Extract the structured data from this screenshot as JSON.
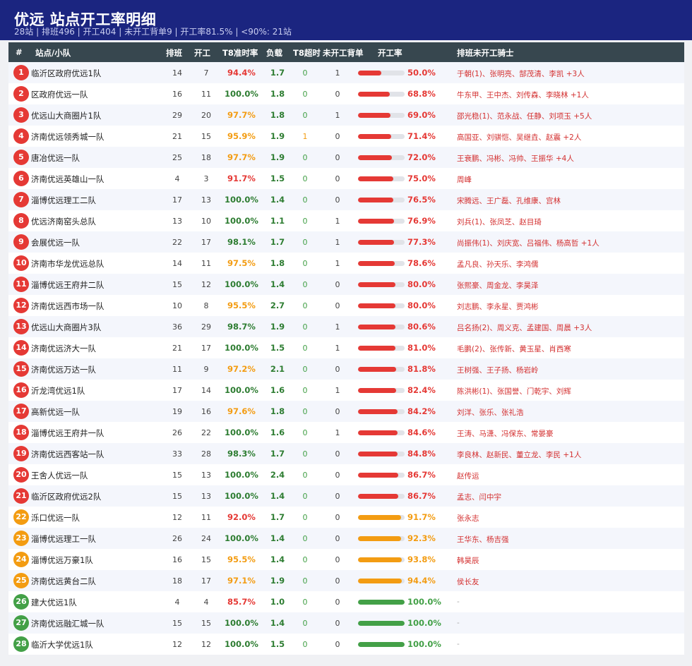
{
  "header": {
    "title": "优远 站点开工率明细",
    "subtitle": "28站 | 排班496 | 开工404 | 未开工背单9 | 开工率81.5% | <90%: 21站"
  },
  "columns": {
    "rank": "#",
    "station": "站点/小队",
    "scheduled": "排班",
    "working": "开工",
    "t8_rate": "T8准时率",
    "load": "负载",
    "t8_overtime": "T8超时",
    "not_working": "未开工背单",
    "work_rate": "开工率",
    "riders": "排班未开工骑士"
  },
  "colors": {
    "red": "#e53935",
    "orange": "#f39c12",
    "green": "#43a047",
    "t8_red": "#e53935",
    "t8_orange": "#f39c12",
    "t8_green": "#2e7d32"
  },
  "rows": [
    {
      "rank": "1",
      "name": "临沂区政府优远1队",
      "scheduled": "14",
      "working": "7",
      "t8": "94.4%",
      "load": "1.7",
      "t8_over": "0",
      "not_working": "1",
      "rate": "50.0%",
      "rate_value": 50.0,
      "riders": "于朝(1)、张明亮、郜茂清、李凯 +3人"
    },
    {
      "rank": "2",
      "name": "区政府优远一队",
      "scheduled": "16",
      "working": "11",
      "t8": "100.0%",
      "load": "1.8",
      "t8_over": "0",
      "not_working": "0",
      "rate": "68.8%",
      "rate_value": 68.8,
      "riders": "牛东甲、王中杰、刘传森、李晓林 +1人"
    },
    {
      "rank": "3",
      "name": "优远山大商圈片1队",
      "scheduled": "29",
      "working": "20",
      "t8": "97.7%",
      "load": "1.8",
      "t8_over": "0",
      "not_working": "1",
      "rate": "69.0%",
      "rate_value": 69.0,
      "riders": "邵光稳(1)、范永战、任静、刘项玉 +5人"
    },
    {
      "rank": "4",
      "name": "济南优远领秀城一队",
      "scheduled": "21",
      "working": "15",
      "t8": "95.9%",
      "load": "1.9",
      "t8_over": "1",
      "not_working": "0",
      "rate": "71.4%",
      "rate_value": 71.4,
      "riders": "高国亚、刘骐恺、吴继垚、赵震 +2人"
    },
    {
      "rank": "5",
      "name": "唐冶优远一队",
      "scheduled": "25",
      "working": "18",
      "t8": "97.7%",
      "load": "1.9",
      "t8_over": "0",
      "not_working": "0",
      "rate": "72.0%",
      "rate_value": 72.0,
      "riders": "王衰鹏、冯彬、冯帅、王振华 +4人"
    },
    {
      "rank": "6",
      "name": "济南优远英雄山一队",
      "scheduled": "4",
      "working": "3",
      "t8": "91.7%",
      "load": "1.5",
      "t8_over": "0",
      "not_working": "0",
      "rate": "75.0%",
      "rate_value": 75.0,
      "riders": "周峰"
    },
    {
      "rank": "7",
      "name": "淄博优远理工二队",
      "scheduled": "17",
      "working": "13",
      "t8": "100.0%",
      "load": "1.4",
      "t8_over": "0",
      "not_working": "0",
      "rate": "76.5%",
      "rate_value": 76.5,
      "riders": "宋腾远、王广磊、孔维康、宫林"
    },
    {
      "rank": "8",
      "name": "优远济南窑头总队",
      "scheduled": "13",
      "working": "10",
      "t8": "100.0%",
      "load": "1.1",
      "t8_over": "0",
      "not_working": "1",
      "rate": "76.9%",
      "rate_value": 76.9,
      "riders": "刘兵(1)、张凤芝、赵目琦"
    },
    {
      "rank": "9",
      "name": "会展优远一队",
      "scheduled": "22",
      "working": "17",
      "t8": "98.1%",
      "load": "1.7",
      "t8_over": "0",
      "not_working": "1",
      "rate": "77.3%",
      "rate_value": 77.3,
      "riders": "尚振伟(1)、刘庆宽、吕福伟、杨高哲 +1人"
    },
    {
      "rank": "10",
      "name": "济南市华龙优远总队",
      "scheduled": "14",
      "working": "11",
      "t8": "97.5%",
      "load": "1.8",
      "t8_over": "0",
      "not_working": "1",
      "rate": "78.6%",
      "rate_value": 78.6,
      "riders": "孟凡良、孙天乐、李鸿儒"
    },
    {
      "rank": "11",
      "name": "淄博优远王府井二队",
      "scheduled": "15",
      "working": "12",
      "t8": "100.0%",
      "load": "1.4",
      "t8_over": "0",
      "not_working": "0",
      "rate": "80.0%",
      "rate_value": 80.0,
      "riders": "张熙豪、周金龙、李昊泽"
    },
    {
      "rank": "12",
      "name": "济南优远西市场一队",
      "scheduled": "10",
      "working": "8",
      "t8": "95.5%",
      "load": "2.7",
      "t8_over": "0",
      "not_working": "0",
      "rate": "80.0%",
      "rate_value": 80.0,
      "riders": "刘志鹏、李永星、贾鸿彬"
    },
    {
      "rank": "13",
      "name": "优远山大商圈片3队",
      "scheduled": "36",
      "working": "29",
      "t8": "98.7%",
      "load": "1.9",
      "t8_over": "0",
      "not_working": "1",
      "rate": "80.6%",
      "rate_value": 80.6,
      "riders": "吕名扬(2)、周义克、孟建国、周晨 +3人"
    },
    {
      "rank": "14",
      "name": "济南优远济大一队",
      "scheduled": "21",
      "working": "17",
      "t8": "100.0%",
      "load": "1.5",
      "t8_over": "0",
      "not_working": "1",
      "rate": "81.0%",
      "rate_value": 81.0,
      "riders": "毛鹏(2)、张传新、黄玉星、肖西寒"
    },
    {
      "rank": "15",
      "name": "济南优远万达一队",
      "scheduled": "11",
      "working": "9",
      "t8": "97.2%",
      "load": "2.1",
      "t8_over": "0",
      "not_working": "0",
      "rate": "81.8%",
      "rate_value": 81.8,
      "riders": "王树强、王子扬、杨岩岭"
    },
    {
      "rank": "16",
      "name": "沂龙湾优远1队",
      "scheduled": "17",
      "working": "14",
      "t8": "100.0%",
      "load": "1.6",
      "t8_over": "0",
      "not_working": "1",
      "rate": "82.4%",
      "rate_value": 82.4,
      "riders": "陈洪彬(1)、张国誉、门乾宇、刘辉"
    },
    {
      "rank": "17",
      "name": "高新优远一队",
      "scheduled": "19",
      "working": "16",
      "t8": "97.6%",
      "load": "1.8",
      "t8_over": "0",
      "not_working": "0",
      "rate": "84.2%",
      "rate_value": 84.2,
      "riders": "刘洋、张乐、张礼浩"
    },
    {
      "rank": "18",
      "name": "淄博优远王府井一队",
      "scheduled": "26",
      "working": "22",
      "t8": "100.0%",
      "load": "1.6",
      "t8_over": "0",
      "not_working": "1",
      "rate": "84.6%",
      "rate_value": 84.6,
      "riders": "王涛、马潇、冯保东、常晏豪"
    },
    {
      "rank": "19",
      "name": "济南优远西客站一队",
      "scheduled": "33",
      "working": "28",
      "t8": "98.3%",
      "load": "1.7",
      "t8_over": "0",
      "not_working": "0",
      "rate": "84.8%",
      "rate_value": 84.8,
      "riders": "李良林、赵新民、董立龙、李民 +1人"
    },
    {
      "rank": "20",
      "name": "王舍人优远一队",
      "scheduled": "15",
      "working": "13",
      "t8": "100.0%",
      "load": "2.4",
      "t8_over": "0",
      "not_working": "0",
      "rate": "86.7%",
      "rate_value": 86.7,
      "riders": "赵传运"
    },
    {
      "rank": "21",
      "name": "临沂区政府优远2队",
      "scheduled": "15",
      "working": "13",
      "t8": "100.0%",
      "load": "1.4",
      "t8_over": "0",
      "not_working": "0",
      "rate": "86.7%",
      "rate_value": 86.7,
      "riders": "孟志、闫中宇"
    },
    {
      "rank": "22",
      "name": "泺口优远一队",
      "scheduled": "12",
      "working": "11",
      "t8": "92.0%",
      "load": "1.7",
      "t8_over": "0",
      "not_working": "0",
      "rate": "91.7%",
      "rate_value": 91.7,
      "riders": "张永志"
    },
    {
      "rank": "23",
      "name": "淄博优远理工一队",
      "scheduled": "26",
      "working": "24",
      "t8": "100.0%",
      "load": "1.4",
      "t8_over": "0",
      "not_working": "0",
      "rate": "92.3%",
      "rate_value": 92.3,
      "riders": "王华东、杨吉强"
    },
    {
      "rank": "24",
      "name": "淄博优远万豪1队",
      "scheduled": "16",
      "working": "15",
      "t8": "95.5%",
      "load": "1.4",
      "t8_over": "0",
      "not_working": "0",
      "rate": "93.8%",
      "rate_value": 93.8,
      "riders": "韩昊辰"
    },
    {
      "rank": "25",
      "name": "济南优远黄台二队",
      "scheduled": "18",
      "working": "17",
      "t8": "97.1%",
      "load": "1.9",
      "t8_over": "0",
      "not_working": "0",
      "rate": "94.4%",
      "rate_value": 94.4,
      "riders": "侯长友"
    },
    {
      "rank": "26",
      "name": "建大优远1队",
      "scheduled": "4",
      "working": "4",
      "t8": "85.7%",
      "load": "1.0",
      "t8_over": "0",
      "not_working": "0",
      "rate": "100.0%",
      "rate_value": 100.0,
      "riders": "-"
    },
    {
      "rank": "27",
      "name": "济南优远融汇城一队",
      "scheduled": "15",
      "working": "15",
      "t8": "100.0%",
      "load": "1.4",
      "t8_over": "0",
      "not_working": "0",
      "rate": "100.0%",
      "rate_value": 100.0,
      "riders": "-"
    },
    {
      "rank": "28",
      "name": "临沂大学优远1队",
      "scheduled": "12",
      "working": "12",
      "t8": "100.0%",
      "load": "1.5",
      "t8_over": "0",
      "not_working": "0",
      "rate": "100.0%",
      "rate_value": 100.0,
      "riders": "-"
    }
  ]
}
